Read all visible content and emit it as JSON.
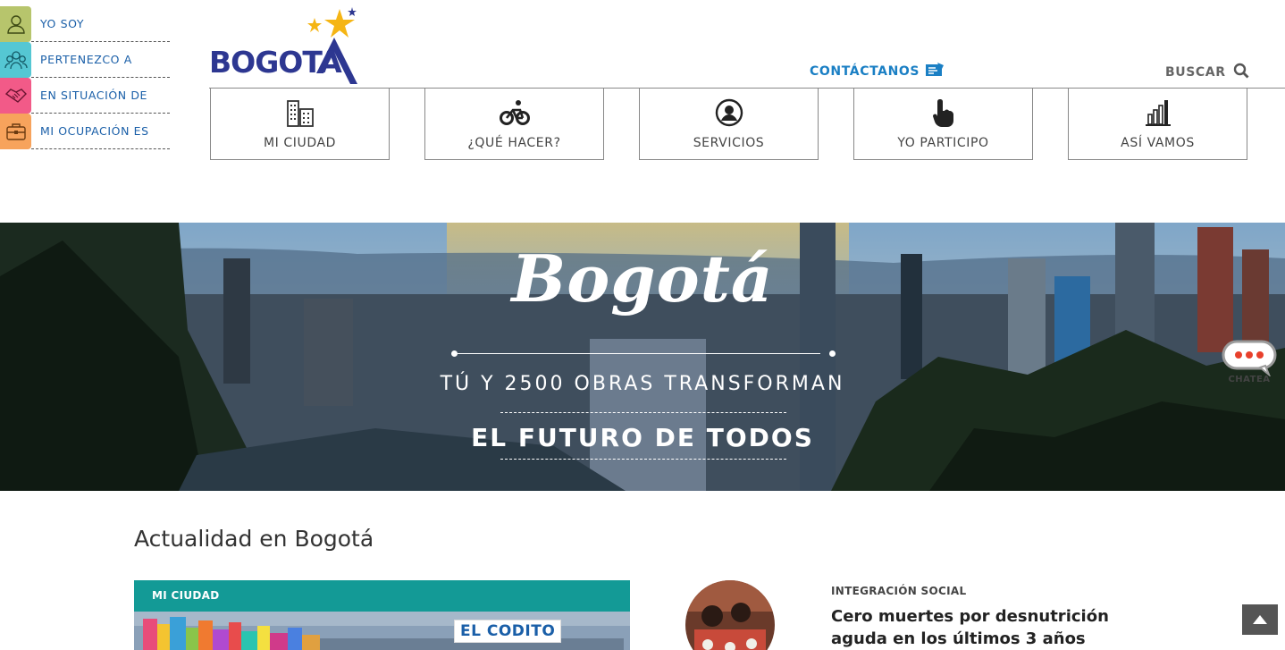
{
  "side_menu": {
    "items": [
      {
        "label": "YO SOY",
        "icon": "person-icon"
      },
      {
        "label": "PERTENEZCO A",
        "icon": "group-icon"
      },
      {
        "label": "EN SITUACIÓN DE",
        "icon": "handshake-icon"
      },
      {
        "label": "MI OCUPACIÓN ES",
        "icon": "briefcase-icon"
      }
    ]
  },
  "logo": {
    "text": "BOGOTA"
  },
  "header": {
    "contact_label": "CONTÁCTANOS",
    "search_label": "BUSCAR"
  },
  "nav": {
    "items": [
      {
        "label": "MI CIUDAD",
        "icon": "buildings-icon"
      },
      {
        "label": "¿QUÉ HACER?",
        "icon": "bicycle-icon"
      },
      {
        "label": "SERVICIOS",
        "icon": "user-circle-icon"
      },
      {
        "label": "YO PARTICIPO",
        "icon": "pointing-hand-icon"
      },
      {
        "label": "ASÍ VAMOS",
        "icon": "bar-chart-icon"
      }
    ]
  },
  "hero": {
    "title": "Bogotá",
    "line1": "TÚ Y 2500 OBRAS TRANSFORMAN",
    "line2": "EL FUTURO DE TODOS"
  },
  "chat": {
    "label": "CHATEA"
  },
  "news": {
    "section_title": "Actualidad en Bogotá",
    "featured": {
      "category": "MI CIUDAD",
      "image_tag": "EL CODITO"
    },
    "item": {
      "category": "INTEGRACIÓN SOCIAL",
      "title": "Cero muertes por desnutrición aguda en los últimos 3 años"
    }
  },
  "colors": {
    "brand_blue": "#2d3791",
    "star_yellow": "#f5b514",
    "link_blue": "#1a7fc4",
    "card_teal": "#139a96"
  }
}
